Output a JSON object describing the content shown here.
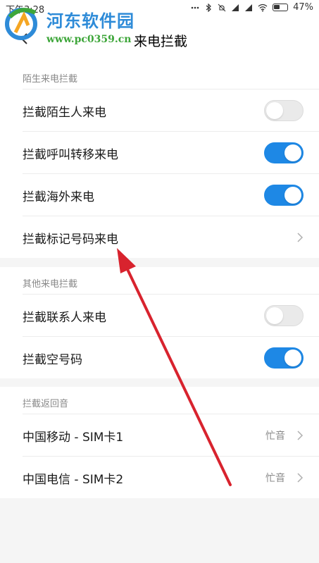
{
  "status_bar": {
    "time": "下午3:28",
    "battery": "47%"
  },
  "header": {
    "title": "来电拦截"
  },
  "watermark": {
    "site_name": "河东软件园",
    "url": "www.pc0359.cn"
  },
  "sections": [
    {
      "title": "陌生来电拦截",
      "rows": [
        {
          "label": "拦截陌生人来电",
          "control": "toggle",
          "on": false
        },
        {
          "label": "拦截呼叫转移来电",
          "control": "toggle",
          "on": true
        },
        {
          "label": "拦截海外来电",
          "control": "toggle",
          "on": true
        },
        {
          "label": "拦截标记号码来电",
          "control": "chevron"
        }
      ]
    },
    {
      "title": "其他来电拦截",
      "rows": [
        {
          "label": "拦截联系人来电",
          "control": "toggle",
          "on": false
        },
        {
          "label": "拦截空号码",
          "control": "toggle",
          "on": true
        }
      ]
    },
    {
      "title": "拦截返回音",
      "rows": [
        {
          "label": "中国移动 - SIM卡1",
          "value": "忙音",
          "control": "chevron"
        },
        {
          "label": "中国电信 - SIM卡2",
          "value": "忙音",
          "control": "chevron"
        }
      ]
    }
  ],
  "colors": {
    "accent": "#1e88e5",
    "annotation_arrow": "#d8232e"
  }
}
